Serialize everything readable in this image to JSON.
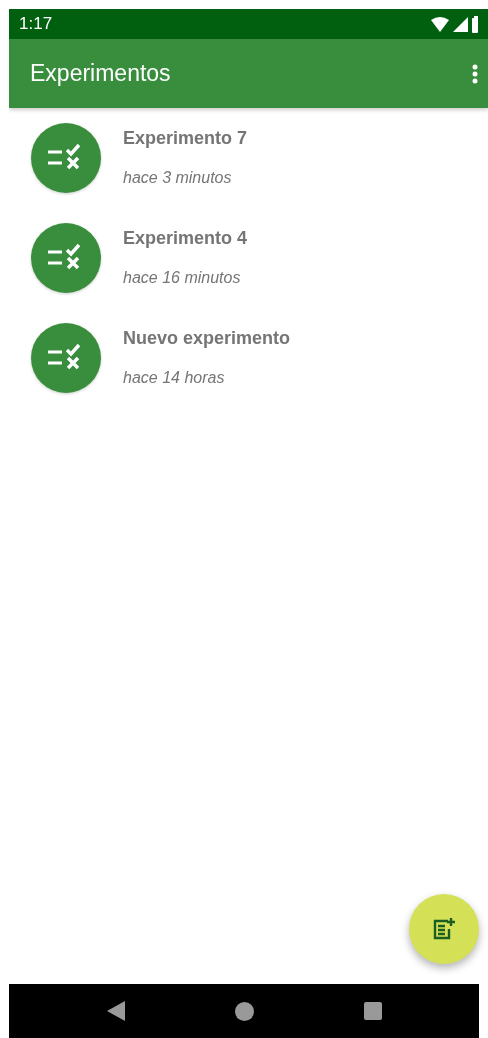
{
  "status_bar": {
    "time": "1:17"
  },
  "app_bar": {
    "title": "Experimentos"
  },
  "experiments": [
    {
      "title": "Experimento 7",
      "subtitle": "hace 3 minutos"
    },
    {
      "title": "Experimento 4",
      "subtitle": "hace 16 minutos"
    },
    {
      "title": "Nuevo experimento",
      "subtitle": "hace 14 horas"
    }
  ]
}
